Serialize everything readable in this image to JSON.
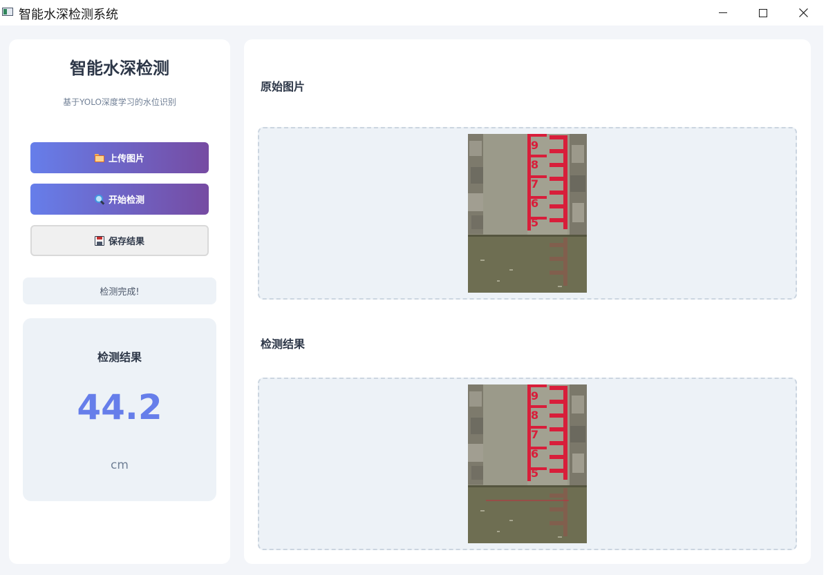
{
  "window": {
    "title": "智能水深检测系统",
    "controls": [
      "minimize",
      "maximize",
      "close"
    ]
  },
  "sidebar": {
    "title": "智能水深检测",
    "subtitle": "基于YOLO深度学习的水位识别",
    "buttons": {
      "upload": {
        "label": "上传图片",
        "icon": "folder-icon"
      },
      "detect": {
        "label": "开始检测",
        "icon": "search-icon"
      },
      "save": {
        "label": "保存结果",
        "icon": "save-icon"
      }
    },
    "status": "检测完成!",
    "result": {
      "label": "检测结果",
      "value": "44.2",
      "unit": "cm"
    }
  },
  "main": {
    "original": {
      "title": "原始图片"
    },
    "detection": {
      "title": "检测结果"
    }
  },
  "colors": {
    "accent": "#667eea",
    "accent_end": "#764ba2",
    "panel_bg": "#edf2f7",
    "gauge_red": "#d81e3a"
  }
}
